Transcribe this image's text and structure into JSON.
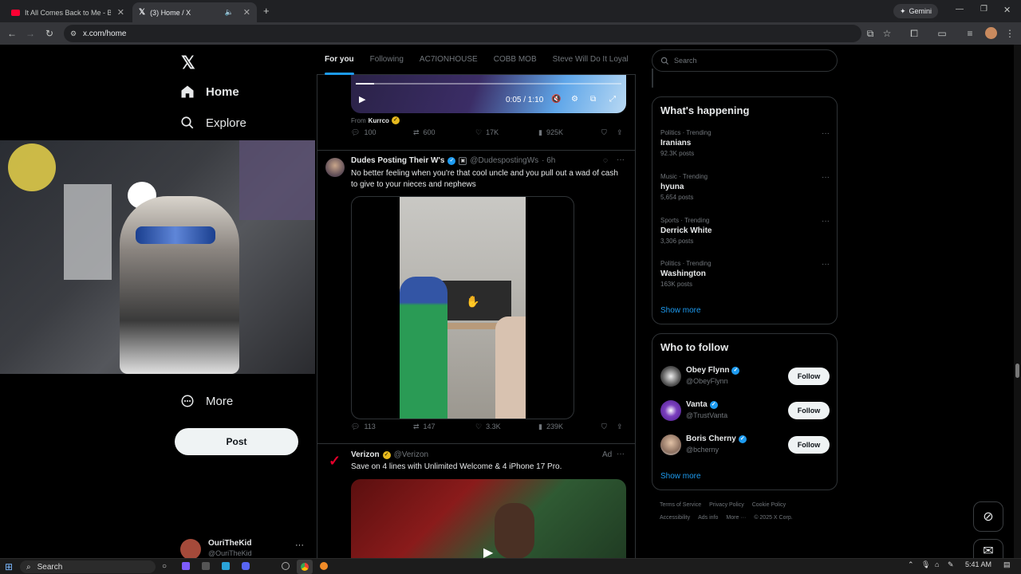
{
  "browser": {
    "tabs": [
      {
        "title": "It All Comes Back to Me - Baby",
        "active": false
      },
      {
        "title": "(3) Home / X",
        "active": true
      }
    ],
    "gemini_label": "Gemini",
    "url": "x.com/home"
  },
  "nav": {
    "home_label": "Home",
    "explore_label": "Explore",
    "more_label": "More",
    "post_label": "Post",
    "user": {
      "name": "OuriTheKid",
      "handle": "@OuriTheKid"
    }
  },
  "feed": {
    "tabs": [
      "For you",
      "Following",
      "AC7IONHOUSE",
      "COBB MOB",
      "Steve Will Do It Loyal"
    ],
    "video_player": {
      "time": "0:05 / 1:10",
      "progress": 0.07
    },
    "from_label": "From",
    "from_name": "Kurrco",
    "post1_stats": {
      "replies": "100",
      "reposts": "600",
      "likes": "17K",
      "views": "925K"
    },
    "post2": {
      "name": "Dudes Posting Their W's",
      "handle": "@DudespostingWs",
      "time": "· 6h",
      "text": "No better feeling when you're that cool uncle and you pull out a wad of cash to give to your nieces and nephews",
      "stats": {
        "replies": "113",
        "reposts": "147",
        "likes": "3.3K",
        "views": "239K"
      }
    },
    "post3": {
      "name": "Verizon",
      "handle": "@Verizon",
      "ad_label": "Ad",
      "text": "Save on 4 lines with Unlimited Welcome & 4 iPhone 17 Pro."
    }
  },
  "sidebar": {
    "search_placeholder": "Search",
    "whats_happening": {
      "title": "What's happening",
      "trends": [
        {
          "meta": "Politics · Trending",
          "name": "Iranians",
          "count": "92.3K posts"
        },
        {
          "meta": "Music · Trending",
          "name": "hyuna",
          "count": "5,654 posts"
        },
        {
          "meta": "Sports · Trending",
          "name": "Derrick White",
          "count": "3,306 posts"
        },
        {
          "meta": "Politics · Trending",
          "name": "Washington",
          "count": "163K posts"
        }
      ],
      "show_more": "Show more"
    },
    "who_to_follow": {
      "title": "Who to follow",
      "accounts": [
        {
          "name": "Obey Flynn",
          "handle": "@ObeyFlynn",
          "follow": "Follow"
        },
        {
          "name": "Vanta",
          "handle": "@TrustVanta",
          "follow": "Follow"
        },
        {
          "name": "Boris Cherny",
          "handle": "@bcherny",
          "follow": "Follow"
        }
      ],
      "show_more": "Show more"
    },
    "footer": [
      "Terms of Service",
      "Privacy Policy",
      "Cookie Policy",
      "Accessibility",
      "Ads info",
      "More ···",
      "© 2025 X Corp."
    ]
  },
  "taskbar": {
    "search_label": "Search",
    "time": "5:41 AM"
  },
  "colors": {
    "accent": "#1d9bf0",
    "verified_gold": "#e6b91e",
    "background": "#000000",
    "border": "#2f3336"
  }
}
